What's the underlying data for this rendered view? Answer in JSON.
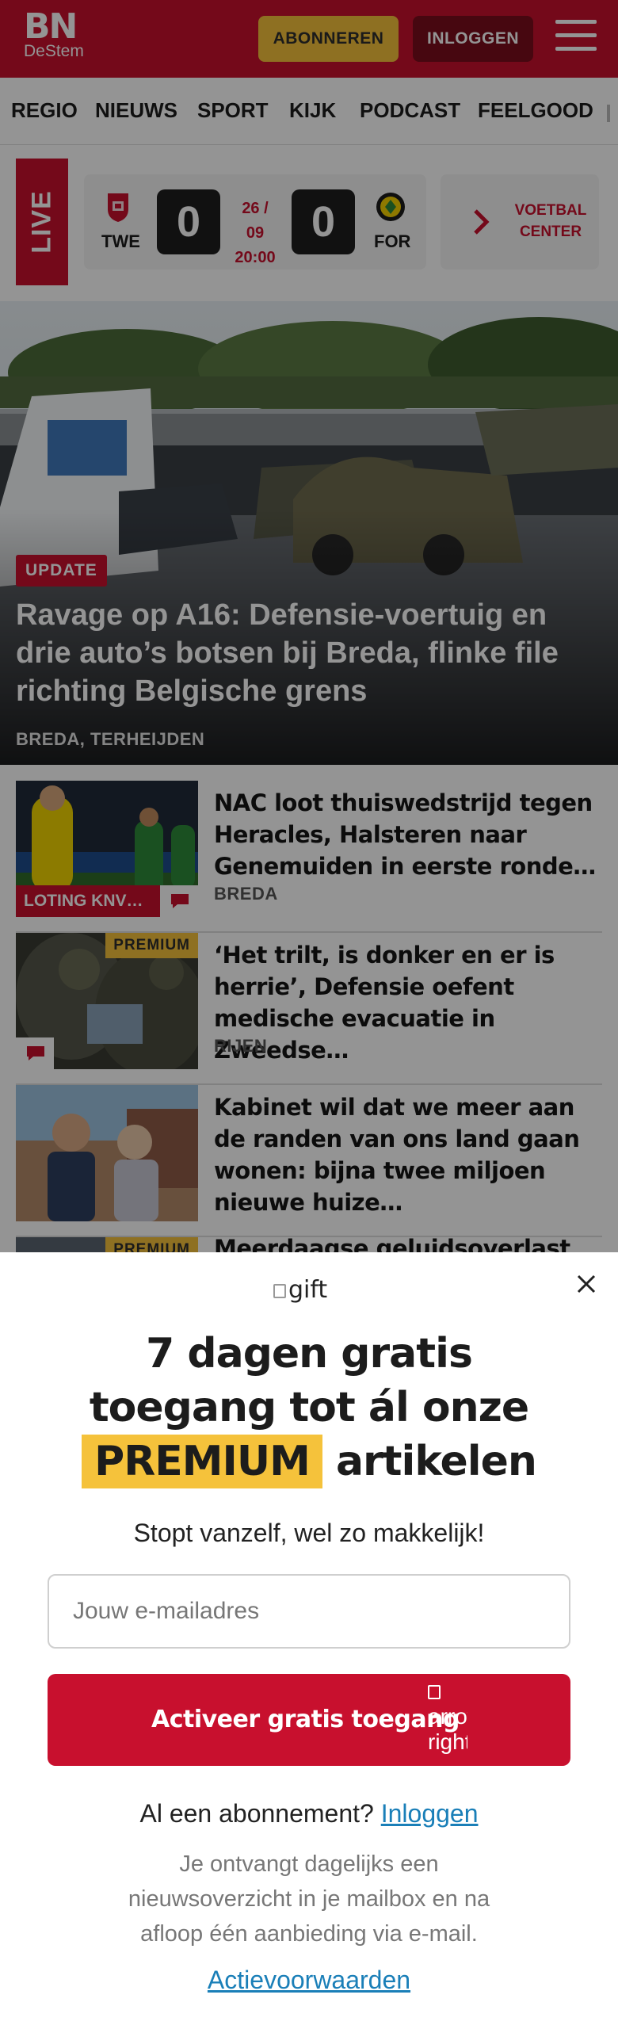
{
  "brand": {
    "logo_main": "BN",
    "logo_sub": "DeStem",
    "accent": "#c8102e",
    "premium_color": "#f5c23b"
  },
  "header": {
    "subscribe_label": "ABONNEREN",
    "login_label": "INLOGGEN",
    "menu_icon": "hamburger-menu-icon"
  },
  "nav": {
    "items": [
      "REGIO",
      "NIEUWS",
      "SPORT",
      "KIJK",
      "PODCAST",
      "FEELGOOD"
    ]
  },
  "live": {
    "label": "LIVE",
    "home_team": "TWE",
    "away_team": "FOR",
    "home_score": "0",
    "away_score": "0",
    "date": "26 / 09",
    "time": "20:00",
    "center_label": "VOETBAL CENTER"
  },
  "hero": {
    "badge": "UPDATE",
    "title": "Ravage op A16: Defensie-voertuig en drie auto’s botsen bij Breda, flinke file richting Belgische grens",
    "location": "BREDA, TERHEIJDEN"
  },
  "articles": [
    {
      "title": "NAC loot thuiswedstrijd tegen Heracles, Halsteren naar Genemuiden in eerste ronde…",
      "location": "BREDA",
      "tag": "LOTING KNV…",
      "premium": ""
    },
    {
      "title": "‘Het trilt, is donker en er is herrie’, Defensie oefent medische evacuatie in Zweedse…",
      "location": "RIJEN",
      "tag": "",
      "premium": "PREMIUM"
    },
    {
      "title": "Kabinet wil dat we meer aan de randen van ons land gaan wonen: bijna twee miljoen nieuwe huize…",
      "location": "",
      "tag": "",
      "premium": ""
    },
    {
      "title": "Meerdaagse geluidsoverlast door…",
      "location": "",
      "tag": "",
      "premium": "PREMIUM"
    }
  ],
  "modal": {
    "gift_alt": "gift",
    "title_line1": "7 dagen gratis",
    "title_line2": "toegang tot ál onze",
    "title_premium": "PREMIUM",
    "title_line3_rest": "artikelen",
    "subtitle": "Stopt vanzelf, wel zo makkelijk!",
    "email_placeholder": "Jouw e-mailadres",
    "cta_label": "Activeer gratis toegang",
    "cta_icon_alt": "arrow right",
    "already_text": "Al een abonnement?",
    "already_link": "Inloggen",
    "info": "Je ontvangt dagelijks een nieuwsoverzicht in je mailbox en na afloop één aanbieding via e-mail.",
    "terms_link": "Actievoorwaarden"
  }
}
